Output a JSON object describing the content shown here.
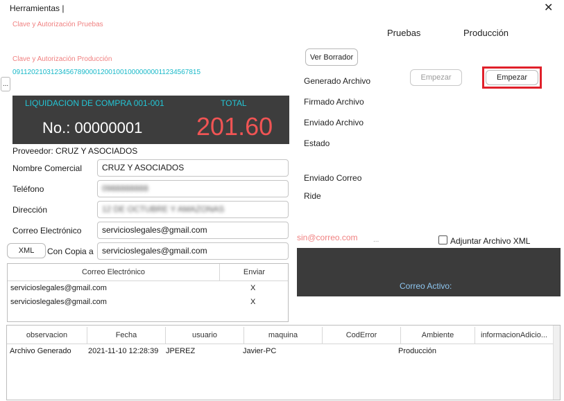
{
  "window": {
    "title": "Herramientas  |",
    "close_glyph": "✕"
  },
  "keys": {
    "test_label": "Clave y Autorización Pruebas",
    "prod_label": "Clave y Autorización Producción",
    "prod_value": "0911202103123456789000120010010000000011234567815",
    "ellipsis_button": "..."
  },
  "columns": {
    "pruebas": "Pruebas",
    "produccion": "Producción"
  },
  "actions": {
    "ver_borrador": "Ver Borrador",
    "empezar_pruebas": "Empezar",
    "empezar_produccion": "Empezar"
  },
  "status": {
    "generado": "Generado Archivo",
    "firmado": "Firmado Archivo",
    "enviado": "Enviado Archivo",
    "estado": "Estado",
    "enviado_correo": "Enviado Correo",
    "ride": "Ride"
  },
  "document": {
    "type": "LIQUIDACION DE COMPRA 001-001",
    "total_label": "TOTAL",
    "number": "No.: 00000001",
    "total": "201.60"
  },
  "proveedor": {
    "line": "Proveedor: CRUZ Y ASOCIADOS",
    "nombre_label": "Nombre Comercial",
    "nombre_value": "CRUZ Y ASOCIADOS",
    "telefono_label": "Teléfono",
    "telefono_value": "0988888888",
    "direccion_label": "Dirección",
    "direccion_value": "12 DE OCTUBRE Y AMAZONAS",
    "correo_label": "Correo Electrónico",
    "correo_value": "servicioslegales@gmail.com",
    "xml_button": "XML",
    "copia_label": "Con Copia a",
    "copia_value": "servicioslegales@gmail.com"
  },
  "email_table": {
    "headers": [
      "Correo Electrónico",
      "Enviar"
    ],
    "rows": [
      [
        "servicioslegales@gmail.com",
        "X"
      ],
      [
        "servicioslegales@gmail.com",
        "X"
      ]
    ]
  },
  "email_panel": {
    "sender": "sin@correo.com",
    "dots": "...",
    "attach_xml": "Adjuntar Archivo XML",
    "active_label": "Correo Activo:"
  },
  "log_table": {
    "headers": [
      "observacion",
      "Fecha",
      "usuario",
      "maquina",
      "CodError",
      "Ambiente",
      "informacionAdicio..."
    ],
    "rows": [
      [
        "Archivo Generado",
        "2021-11-10 12:28:39",
        "JPEREZ",
        "Javier-PC",
        "",
        "Producción",
        ""
      ]
    ]
  }
}
